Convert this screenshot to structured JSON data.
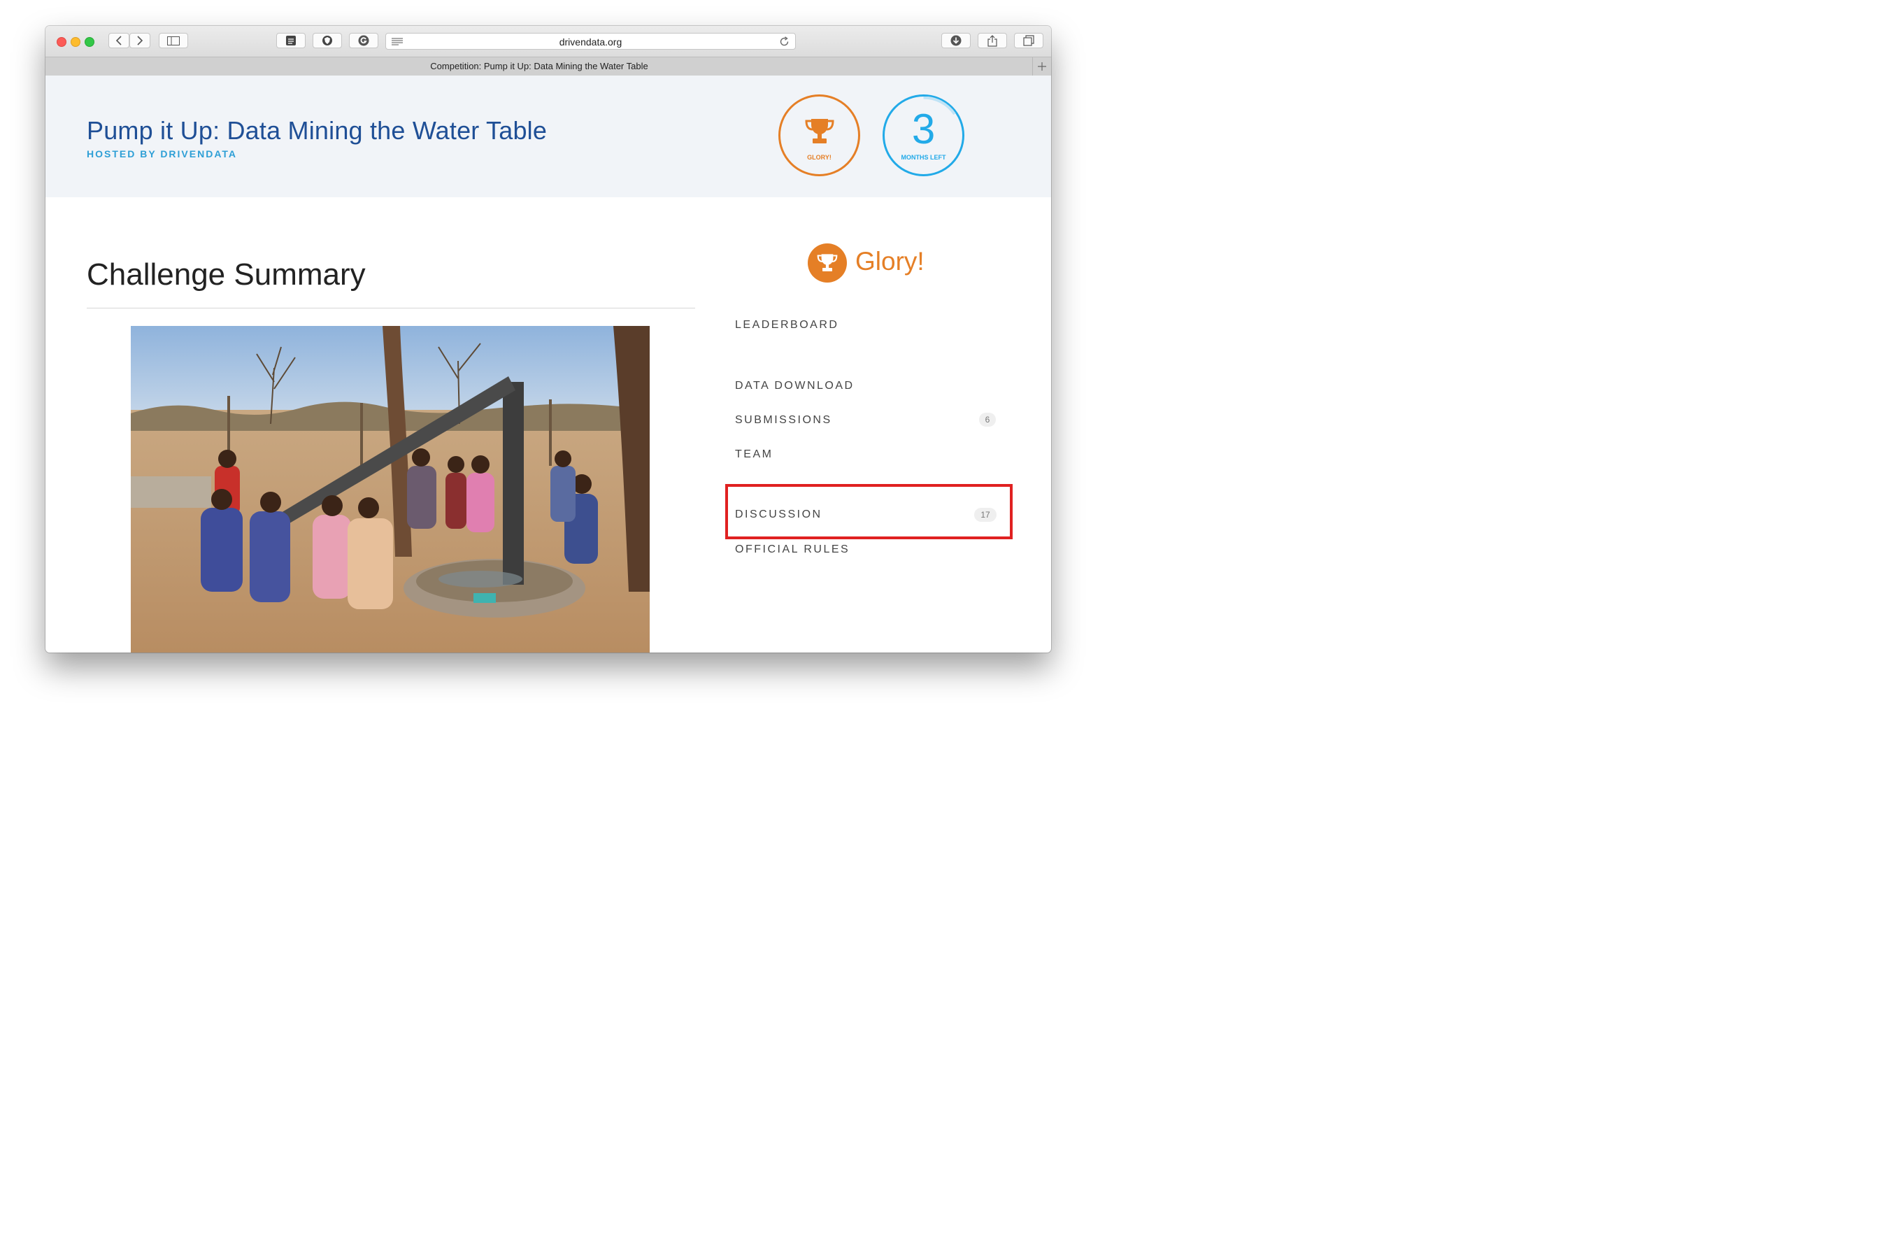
{
  "browser": {
    "url": "drivendata.org",
    "tab_title": "Competition: Pump it Up: Data Mining the Water Table"
  },
  "header": {
    "title": "Pump it Up: Data Mining the Water Table",
    "hosted_by": "HOSTED BY DRIVENDATA",
    "prize_badge_label": "GLORY!",
    "time_left_number": "3",
    "time_left_label": "MONTHS LEFT"
  },
  "main": {
    "section_title": "Challenge Summary"
  },
  "sidebar": {
    "prize_text": "Glory!",
    "nav": {
      "leaderboard": "LEADERBOARD",
      "data_download": "DATA DOWNLOAD",
      "submissions": "SUBMISSIONS",
      "submissions_count": "6",
      "team": "TEAM",
      "discussion": "DISCUSSION",
      "discussion_count": "17",
      "official_rules": "OFFICIAL RULES"
    }
  },
  "colors": {
    "title_blue": "#1f4f96",
    "accent_blue": "#22aae8",
    "prize_orange": "#e57f26",
    "highlight_red": "#e02121"
  },
  "icons": [
    "back-icon",
    "forward-icon",
    "sidebar-icon",
    "reader-icon",
    "reload-icon",
    "download-icon",
    "share-icon",
    "tabs-icon",
    "trophy-icon",
    "plus-icon"
  ]
}
